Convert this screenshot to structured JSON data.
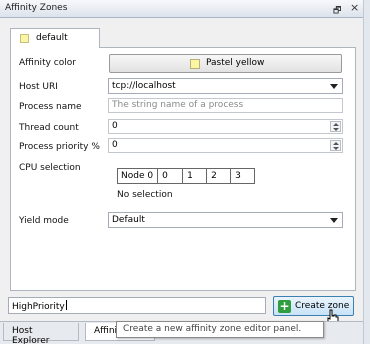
{
  "window": {
    "title": "Affinity Zones",
    "pin_glyph": "🗗",
    "close_glyph": "×"
  },
  "zone_tab": {
    "label": "default",
    "color": "#fbf6a4"
  },
  "form": {
    "affinity_color": {
      "label": "Affinity color",
      "value": "Pastel yellow"
    },
    "host_uri": {
      "label": "Host URI",
      "value": "tcp://localhost"
    },
    "process_name": {
      "label": "Process name",
      "placeholder": "The string name of a process"
    },
    "thread_count": {
      "label": "Thread count",
      "value": "0"
    },
    "process_priority": {
      "label": "Process priority %",
      "value": "0"
    },
    "cpu_selection": {
      "label": "CPU selection",
      "node_label": "Node 0",
      "cpus": [
        "0",
        "1",
        "2",
        "3"
      ],
      "status": "No selection"
    },
    "yield_mode": {
      "label": "Yield mode",
      "value": "Default"
    }
  },
  "zone_name_input": {
    "value": "HighPriority"
  },
  "create_button": {
    "label": "Create zone",
    "tooltip": "Create a new affinity zone editor panel."
  },
  "bottom_tabs": [
    "Host Explorer",
    "Affinity Zones"
  ]
}
